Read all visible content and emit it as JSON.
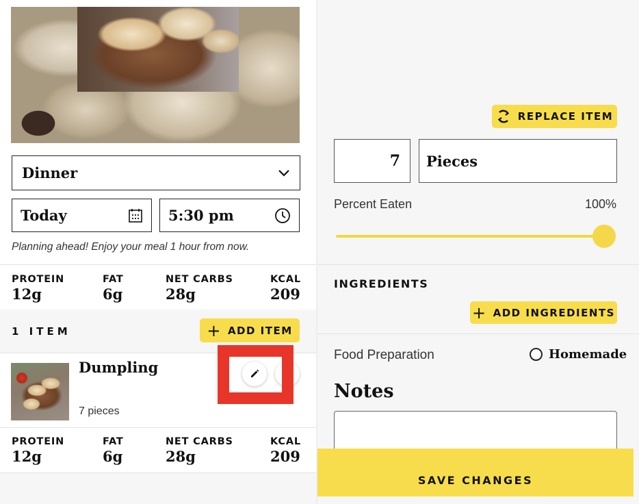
{
  "left": {
    "meal_type": "Dinner",
    "date": "Today",
    "time": "5:30 pm",
    "hint": "Planning ahead! Enjoy your meal 1 hour from now.",
    "summary_macros": [
      {
        "label": "PROTEIN",
        "value": "12g"
      },
      {
        "label": "FAT",
        "value": "6g"
      },
      {
        "label": "NET CARBS",
        "value": "28g"
      },
      {
        "label": "KCAL",
        "value": "209"
      }
    ],
    "items_heading": "1 ITEM",
    "add_item_label": "ADD ITEM",
    "item": {
      "name": "Dumpling",
      "quantity": "7 pieces"
    },
    "item_macros": [
      {
        "label": "PROTEIN",
        "value": "12g"
      },
      {
        "label": "FAT",
        "value": "6g"
      },
      {
        "label": "NET CARBS",
        "value": "28g"
      },
      {
        "label": "KCAL",
        "value": "209"
      }
    ]
  },
  "right": {
    "replace_label": "REPLACE ITEM",
    "quantity": "7",
    "unit": "Pieces",
    "percent_label": "Percent Eaten",
    "percent_value": "100%",
    "percent_fraction": 1.0,
    "ingredients_title": "INGREDIENTS",
    "add_ingredients_label": "ADD INGREDIENTS",
    "food_prep_label": "Food Preparation",
    "food_prep_option": "Homemade",
    "notes_title": "Notes",
    "notes_value": "",
    "save_label": "SAVE CHANGES"
  },
  "colors": {
    "accent_yellow": "#f7dd4b",
    "highlight_red": "#e8352a"
  },
  "icons": {
    "meal_dropdown": "chevron-down-icon",
    "date": "calendar-icon",
    "time": "clock-icon",
    "add": "plus-icon",
    "edit": "pencil-icon",
    "replace": "refresh-icon",
    "radio": "radio-unchecked-icon"
  }
}
